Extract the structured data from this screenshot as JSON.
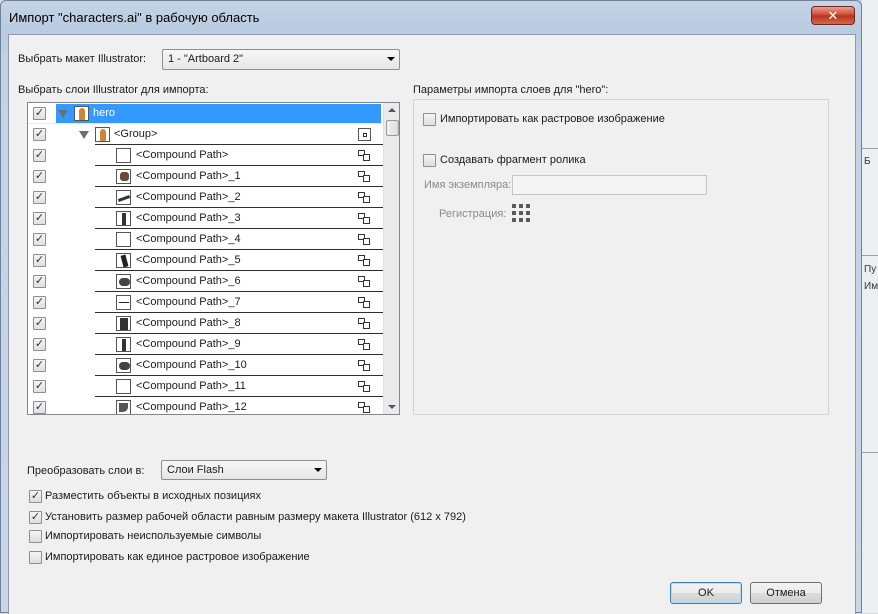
{
  "window": {
    "title": "Импорт \"characters.ai\" в рабочую область",
    "close_glyph": "✕"
  },
  "artboard": {
    "label": "Выбрать макет Illustrator:",
    "selected": "1 - \"Artboard 2\""
  },
  "layers": {
    "label": "Выбрать слои Illustrator для импорта:",
    "check_glyph": "✓",
    "rows": [
      {
        "name": "hero",
        "icon": "person-icon",
        "checked": true,
        "selected": true
      },
      {
        "name": "<Group>",
        "icon": "person-icon",
        "checked": true
      },
      {
        "name": "<Compound Path>",
        "icon": "blank-thumb",
        "checked": true
      },
      {
        "name": "<Compound Path>_1",
        "icon": "blob-thumb",
        "checked": true
      },
      {
        "name": "<Compound Path>_2",
        "icon": "slash-thumb",
        "checked": true
      },
      {
        "name": "<Compound Path>_3",
        "icon": "bar-thumb",
        "checked": true
      },
      {
        "name": "<Compound Path>_4",
        "icon": "blank-thumb",
        "checked": true
      },
      {
        "name": "<Compound Path>_5",
        "icon": "leg-thumb",
        "checked": true
      },
      {
        "name": "<Compound Path>_6",
        "icon": "round-thumb",
        "checked": true
      },
      {
        "name": "<Compound Path>_7",
        "icon": "dash-thumb",
        "checked": true
      },
      {
        "name": "<Compound Path>_8",
        "icon": "block-thumb",
        "checked": true
      },
      {
        "name": "<Compound Path>_9",
        "icon": "bar-thumb",
        "checked": true
      },
      {
        "name": "<Compound Path>_10",
        "icon": "round-thumb",
        "checked": true
      },
      {
        "name": "<Compound Path>_11",
        "icon": "blank-thumb",
        "checked": true
      },
      {
        "name": "<Compound Path>_12",
        "icon": "claw-thumb",
        "checked": true
      }
    ]
  },
  "options": {
    "heading": "Параметры импорта слоев для \"hero\":",
    "import_bitmap": "Импортировать как растровое изображение",
    "create_movieclip": "Создавать фрагмент ролика",
    "instance_name_label": "Имя экземпляра:",
    "instance_name_value": "",
    "registration_label": "Регистрация:"
  },
  "convert": {
    "label": "Преобразовать слои в:",
    "selected": "Слои Flash"
  },
  "checkboxes": [
    {
      "label": "Разместить объекты в исходных позициях",
      "checked": true
    },
    {
      "label": "Установить размер рабочей области равным размеру макета Illustrator (612 x 792)",
      "checked": true
    },
    {
      "label": "Импортировать неиспользуемые символы",
      "checked": false
    },
    {
      "label": "Импортировать как единое растровое изображение",
      "checked": false
    }
  ],
  "buttons": {
    "ok": "OK",
    "cancel": "Отмена"
  },
  "background_app": {
    "items": [
      "Б",
      "Пу",
      "Им"
    ]
  }
}
